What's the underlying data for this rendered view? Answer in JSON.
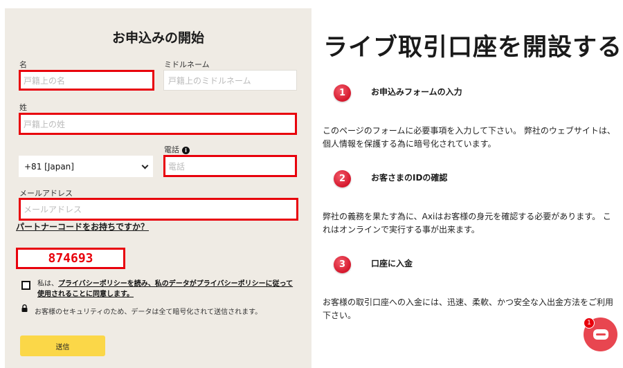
{
  "form": {
    "title": "お申込みの開始",
    "first_name": {
      "label": "名",
      "placeholder": "戸籍上の名"
    },
    "middle_name": {
      "label": "ミドルネーム",
      "placeholder": "戸籍上のミドルネーム"
    },
    "last_name": {
      "label": "姓",
      "placeholder": "戸籍上の姓"
    },
    "phone": {
      "label": "電話",
      "placeholder": "電話",
      "country_code": "+81 [Japan]"
    },
    "email": {
      "label": "メールアドレス",
      "placeholder": "メールアドレス"
    },
    "partner_link": "パートナーコードをお持ちですか？",
    "partner_code": "874693",
    "consent_prefix": "私は、",
    "consent_link1": "プライバシーポリシーを読み、私のデータがプライバシーポリシーに従って使用されることに同意します。",
    "security_note": "お客様のセキュリティのため、データは全て暗号化されて送信されます。",
    "submit_label": "送信"
  },
  "info": {
    "heading": "ライブ取引口座を開設する",
    "steps": [
      {
        "number": "1",
        "title": "お申込みフォームの入力",
        "description": "このページのフォームに必要事項を入力して下さい。 弊社のウェブサイトは、個人情報を保護する為に暗号化されています。"
      },
      {
        "number": "2",
        "title": "お客さまのIDの確認",
        "description": "弊社の義務を果たす為に、Axiはお客様の身元を確認する必要があります。 これはオンラインで実行する事が出来ます。"
      },
      {
        "number": "3",
        "title": "口座に入金",
        "description": "お客様の取引口座への入金には、迅速、柔軟、かつ安全な入出金方法をご利用下さい。"
      }
    ]
  },
  "chat": {
    "badge_count": "1",
    "icon": "chat-bubble-icon"
  },
  "colors": {
    "error_border": "#e8000b",
    "panel_bg": "#efebe4",
    "submit_bg": "#fbd748",
    "badge_red": "#d5172c"
  }
}
